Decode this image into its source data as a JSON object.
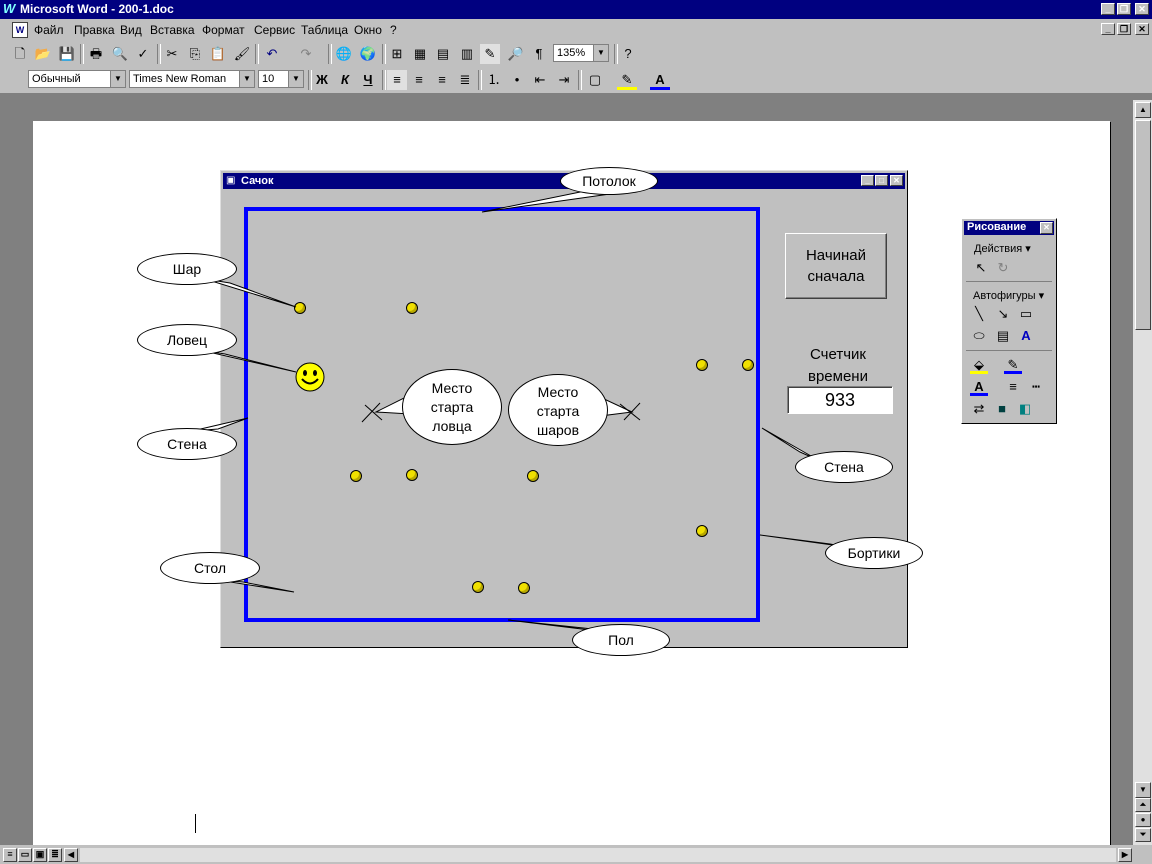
{
  "window": {
    "title": "Microsoft Word - 200-1.doc",
    "app_icon": "W"
  },
  "menu": [
    "Файл",
    "Правка",
    "Вид",
    "Вставка",
    "Формат",
    "Сервис",
    "Таблица",
    "Окно",
    "?"
  ],
  "toolbar": {
    "zoom": "135%",
    "style": "Обычный",
    "font": "Times New Roman",
    "size": "10",
    "bold": "Ж",
    "italic": "К",
    "underline": "Ч",
    "pilcrow": "¶"
  },
  "app": {
    "title": "Сачок",
    "restart_button_line1": "Начинай",
    "restart_button_line2": "сначала",
    "timer_label_line1": "Счетчик",
    "timer_label_line2": "времени",
    "timer_value": "933"
  },
  "callouts": {
    "ceiling": "Потолок",
    "ball": "Шар",
    "catcher": "Ловец",
    "wall_left": "Стена",
    "wall_right": "Стена",
    "table": "Стол",
    "floor": "Пол",
    "rails": "Бортики",
    "catcher_start_1": "Место",
    "catcher_start_2": "старта",
    "catcher_start_3": "ловца",
    "balls_start_1": "Место",
    "balls_start_2": "старта",
    "balls_start_3": "шаров"
  },
  "drawing_toolbar": {
    "title": "Рисование",
    "actions": "Действия",
    "autoshapes": "Автофигуры"
  },
  "colors": {
    "titlebar": "#000080",
    "table_border": "#0000ff",
    "ball": "#f0e000",
    "face": "#c0c0c0"
  }
}
